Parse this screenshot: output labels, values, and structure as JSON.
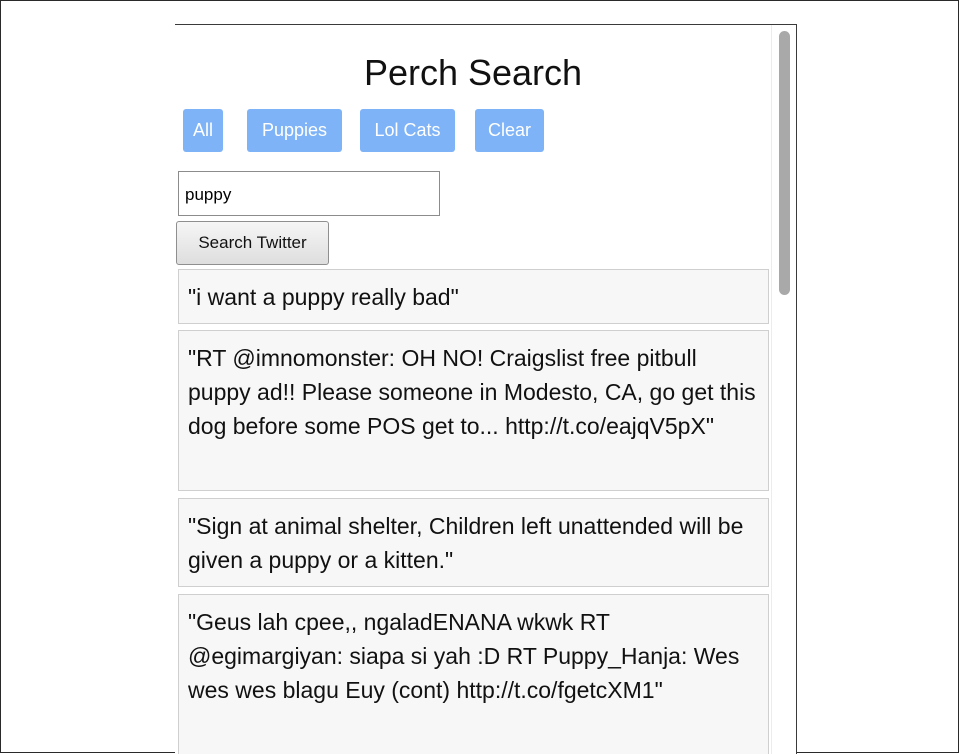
{
  "app": {
    "title": "Perch Search"
  },
  "presets": [
    {
      "label": "All"
    },
    {
      "label": "Puppies"
    },
    {
      "label": "Lol Cats"
    },
    {
      "label": "Clear"
    }
  ],
  "search": {
    "value": "puppy",
    "button_label": "Search Twitter"
  },
  "tweets": [
    {
      "text": "\"i want a puppy really bad\""
    },
    {
      "text": "\"RT @imnomonster: OH NO! Craigslist free pitbull puppy ad!! Please someone in Modesto, CA, go get this dog before some POS get to... http://t.co/eajqV5pX\""
    },
    {
      "text": "\"Sign at animal shelter, Children left unattended will be given a puppy or a kitten.\""
    },
    {
      "text": "\"Geus lah cpee,, ngaladENANA wkwk RT @egimargiyan: siapa si yah :D RT Puppy_Hanja: Wes wes wes blagu Euy (cont) http://t.co/fgetcXM1\""
    }
  ],
  "colors": {
    "preset_button_bg": "#7fb3f7",
    "tweet_bg": "#f7f7f7"
  }
}
